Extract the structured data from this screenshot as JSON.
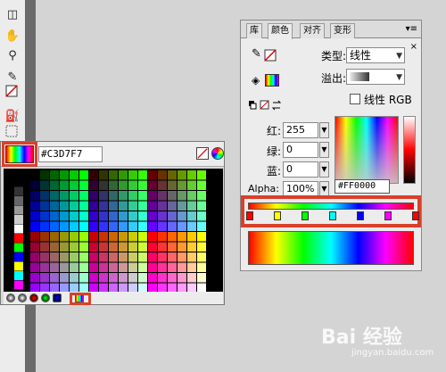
{
  "swatches": {
    "current_hex": "#C3D7F7",
    "ramp_colors": [
      "#000000",
      "#333333",
      "#666666",
      "#999999",
      "#CCCCCC",
      "#FFFFFF",
      "#FF0000",
      "#00FF00",
      "#0000FF",
      "#FFFF00",
      "#00FFFF",
      "#FF00FF"
    ]
  },
  "mixer": {
    "tabs": [
      "库",
      "颜色",
      "对齐",
      "变形"
    ],
    "active_tab": "颜色",
    "type_label": "类型:",
    "type_value": "线性",
    "overflow_label": "溢出:",
    "linear_rgb_label": "线性 RGB",
    "red_label": "红:",
    "red_value": "255",
    "green_label": "绿:",
    "green_value": "0",
    "blue_label": "蓝:",
    "blue_value": "0",
    "alpha_label": "Alpha:",
    "alpha_value": "100%",
    "hex_value": "#FF0000",
    "stops": [
      "#FF0000",
      "#FFFF00",
      "#00FF00",
      "#00FFFF",
      "#0000FF",
      "#FF00FF",
      "#FF0000"
    ]
  },
  "watermark": {
    "text": "Bai 经验",
    "sub": "jingyan.baidu.com"
  }
}
